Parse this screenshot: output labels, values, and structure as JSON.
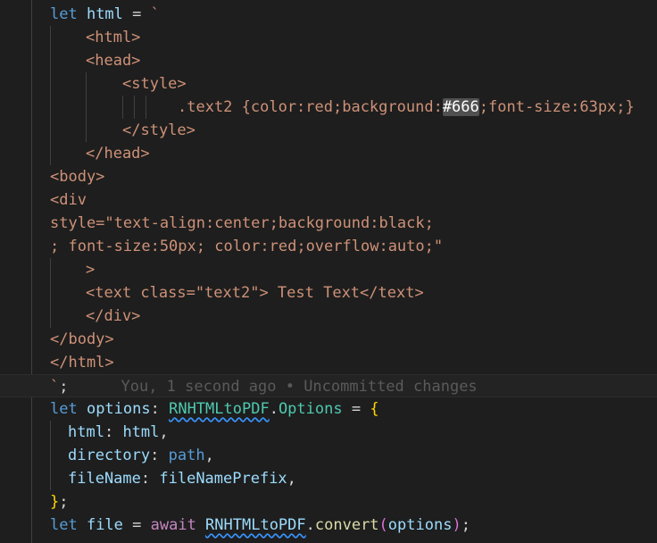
{
  "lines": [
    [
      [
        "kw",
        "let "
      ],
      [
        "var",
        "html"
      ],
      [
        "op",
        " = "
      ],
      [
        "str",
        "`"
      ]
    ],
    [
      [
        "str",
        "<html>"
      ]
    ],
    [
      [
        "str",
        "<head>"
      ]
    ],
    [
      [
        "str",
        "<style>"
      ]
    ],
    [
      [
        "str",
        ".text2 {color:red;background:"
      ],
      [
        "hl",
        "#666"
      ],
      [
        "str",
        ";font-size:63px;}"
      ]
    ],
    [
      [
        "str",
        "</style>"
      ]
    ],
    [
      [
        "str",
        "</head>"
      ]
    ],
    [
      [
        "str",
        "<body>"
      ]
    ],
    [
      [
        "str",
        "<div"
      ]
    ],
    [
      [
        "str",
        "style=\"text-align:center;background:black;"
      ]
    ],
    [
      [
        "str",
        "; font-size:50px; color:red;overflow:auto;\""
      ]
    ],
    [
      [
        "str",
        ">"
      ]
    ],
    [
      [
        "str",
        "<text class=\"text2\"> Test Text</text>"
      ]
    ],
    [
      [
        "str",
        "</div>"
      ]
    ],
    [
      [
        "str",
        "</body>"
      ]
    ],
    [
      [
        "str",
        "</html>"
      ]
    ],
    [
      [
        "str",
        "`"
      ],
      [
        "op",
        ";"
      ]
    ],
    [
      [
        "kw",
        "let "
      ],
      [
        "var",
        "options"
      ],
      [
        "op",
        ": "
      ],
      [
        "cls-sq",
        "RNHTMLtoPDF"
      ],
      [
        "op",
        "."
      ],
      [
        "cls",
        "Options"
      ],
      [
        "op",
        " = "
      ],
      [
        "brace2",
        "{"
      ]
    ],
    [
      [
        "var",
        "html"
      ],
      [
        "op",
        ": "
      ],
      [
        "var",
        "html"
      ],
      [
        "op",
        ","
      ]
    ],
    [
      [
        "var",
        "directory"
      ],
      [
        "op",
        ": "
      ],
      [
        "kw",
        "path"
      ],
      [
        "op",
        ","
      ]
    ],
    [
      [
        "var",
        "fileName"
      ],
      [
        "op",
        ": "
      ],
      [
        "var",
        "fileNamePrefix"
      ],
      [
        "op",
        ","
      ]
    ],
    [
      [
        "brace2",
        "}"
      ],
      [
        "op",
        ";"
      ]
    ],
    [
      [
        "kw",
        "let "
      ],
      [
        "var",
        "file"
      ],
      [
        "op",
        " = "
      ],
      [
        "ctrl",
        "await "
      ],
      [
        "var-sq",
        "RNHTMLtoPDF"
      ],
      [
        "op",
        "."
      ],
      [
        "fn",
        "convert"
      ],
      [
        "brace1",
        "("
      ],
      [
        "var",
        "options"
      ],
      [
        "brace1",
        ")"
      ],
      [
        "op",
        ";"
      ]
    ]
  ],
  "blame_text": "You, 1 second ago • Uncommitted changes"
}
